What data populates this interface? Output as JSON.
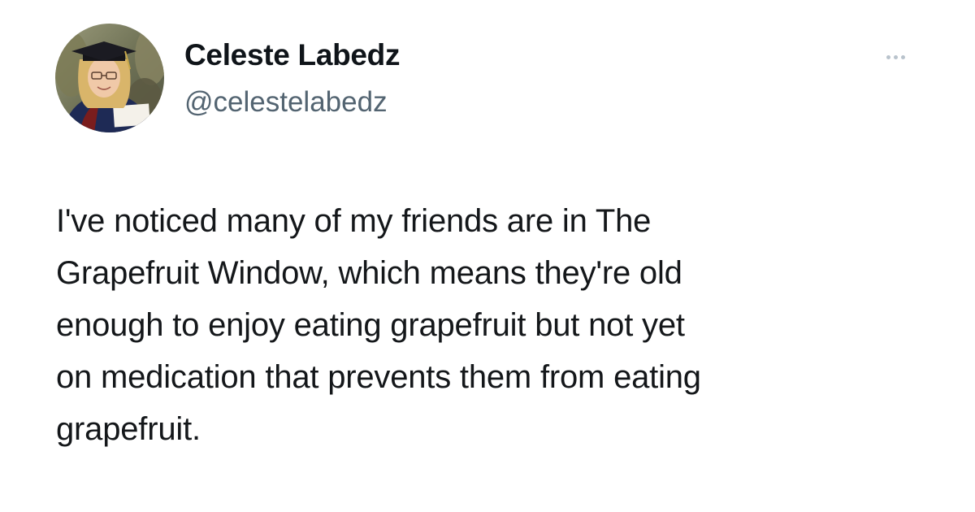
{
  "author": {
    "display_name": "Celeste Labedz",
    "handle": "@celestelabedz",
    "avatar_icon": "graduation-portrait-avatar"
  },
  "menu": {
    "icon": "more-options-icon"
  },
  "tweet": {
    "text": "I've noticed many of my friends are in The\nGrapefruit Window, which means they're old\nenough to enjoy eating grapefruit but not yet\non medication that prevents them from eating\ngrapefruit."
  },
  "colors": {
    "text": "#0f1419",
    "secondary_text": "#536471",
    "background": "#ffffff"
  }
}
